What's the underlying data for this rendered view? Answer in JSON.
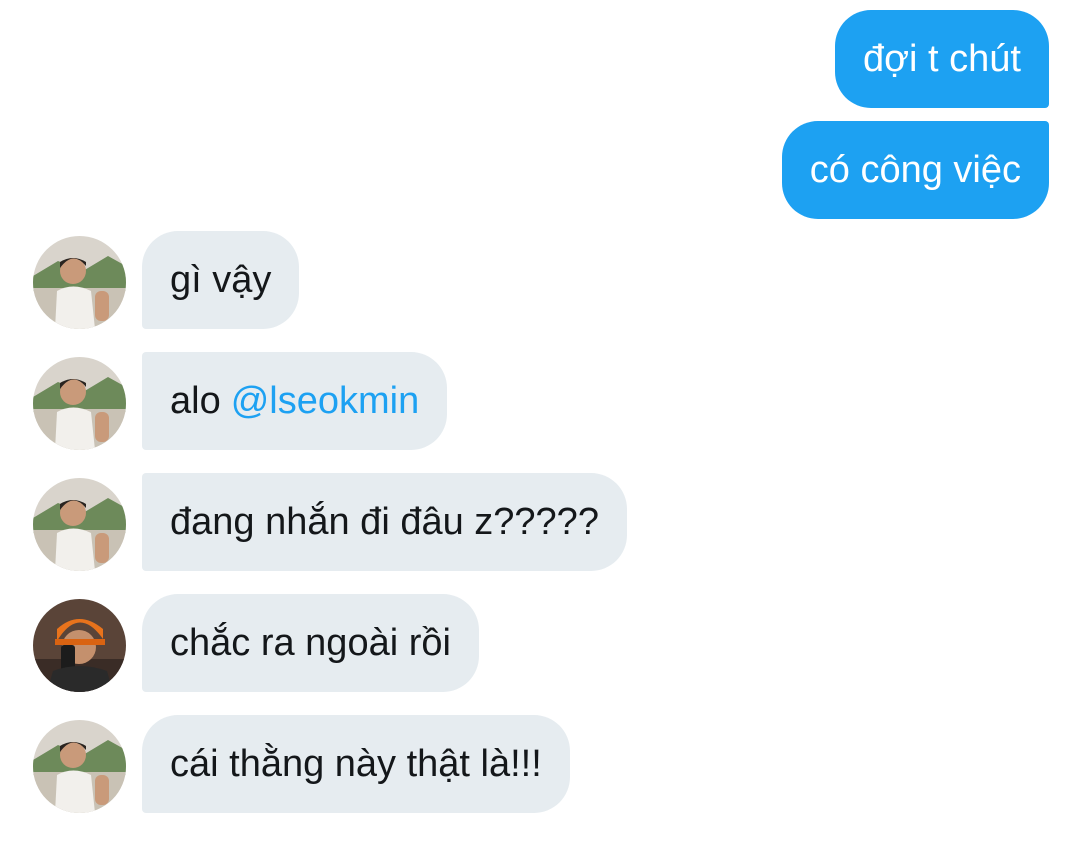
{
  "messages": [
    {
      "side": "sent",
      "text": "đợi t chút"
    },
    {
      "side": "sent",
      "text": "có công việc"
    },
    {
      "side": "received",
      "avatar": "avatar-user-a",
      "text": "gì vậy"
    },
    {
      "side": "received",
      "avatar": "avatar-user-a",
      "text": "alo",
      "mention": "@lseokmin"
    },
    {
      "side": "received",
      "avatar": "avatar-user-a",
      "text": "đang nhắn đi đâu z?????"
    },
    {
      "side": "received",
      "avatar": "avatar-user-b",
      "text": "chắc ra ngoài rồi"
    },
    {
      "side": "received",
      "avatar": "avatar-user-a",
      "text": "cái thằng này thật là!!!"
    }
  ],
  "colors": {
    "sent_bubble": "#1da1f2",
    "received_bubble": "#e6ecf0",
    "mention": "#1da1f2",
    "text_dark": "#14171a"
  }
}
